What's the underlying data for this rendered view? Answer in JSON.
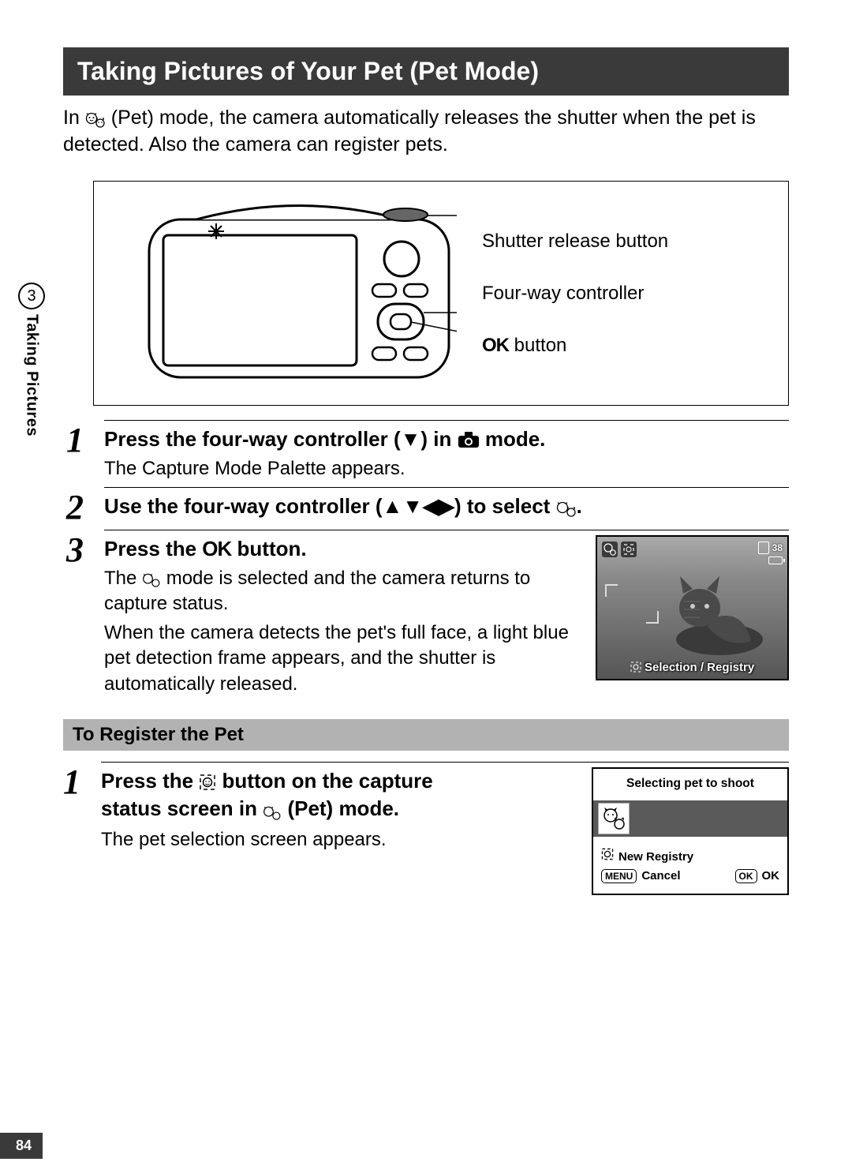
{
  "title": "Taking Pictures of Your Pet (Pet Mode)",
  "intro": {
    "prefix": "In ",
    "mode_label": "(Pet) mode, the camera automatically releases the shutter when the pet is detected. Also the camera can register pets."
  },
  "diagram": {
    "shutter_label": "Shutter release button",
    "controller_label": "Four-way controller",
    "ok_label_prefix": "OK",
    "ok_label_suffix": " button"
  },
  "side": {
    "number": "3",
    "text": "Taking Pictures"
  },
  "steps": [
    {
      "num": "1",
      "title_before": "Press the four-way controller (",
      "title_arrow": "▼",
      "title_mid": ") in ",
      "title_after": " mode.",
      "desc": "The Capture Mode Palette appears."
    },
    {
      "num": "2",
      "title_before": "Use the four-way controller (",
      "title_arrows": "▲▼◀▶",
      "title_mid": ") to select ",
      "title_after": "."
    },
    {
      "num": "3",
      "title_before": "Press the ",
      "title_ok": "OK",
      "title_after": " button.",
      "desc_before": "The ",
      "desc_after": " mode is selected and the camera returns to capture status.",
      "desc_line2": "When the camera detects the pet's full face, a light blue pet detection frame appears, and the shutter is automatically released."
    }
  ],
  "preview": {
    "counter": "38",
    "overlay": "Selection / Registry"
  },
  "subheader": "To Register the Pet",
  "reg_step": {
    "num": "1",
    "title_l1_before": "Press the ",
    "title_l1_after": " button on the capture",
    "title_l2_before": "status screen in ",
    "title_l2_after": " (Pet) mode.",
    "desc": "The pet selection screen appears."
  },
  "menu": {
    "title": "Selecting pet to shoot",
    "new_registry": "New Registry",
    "menu_btn": "MENU",
    "cancel": "Cancel",
    "ok_btn": "OK",
    "ok_text": "OK"
  },
  "page_number": "84"
}
